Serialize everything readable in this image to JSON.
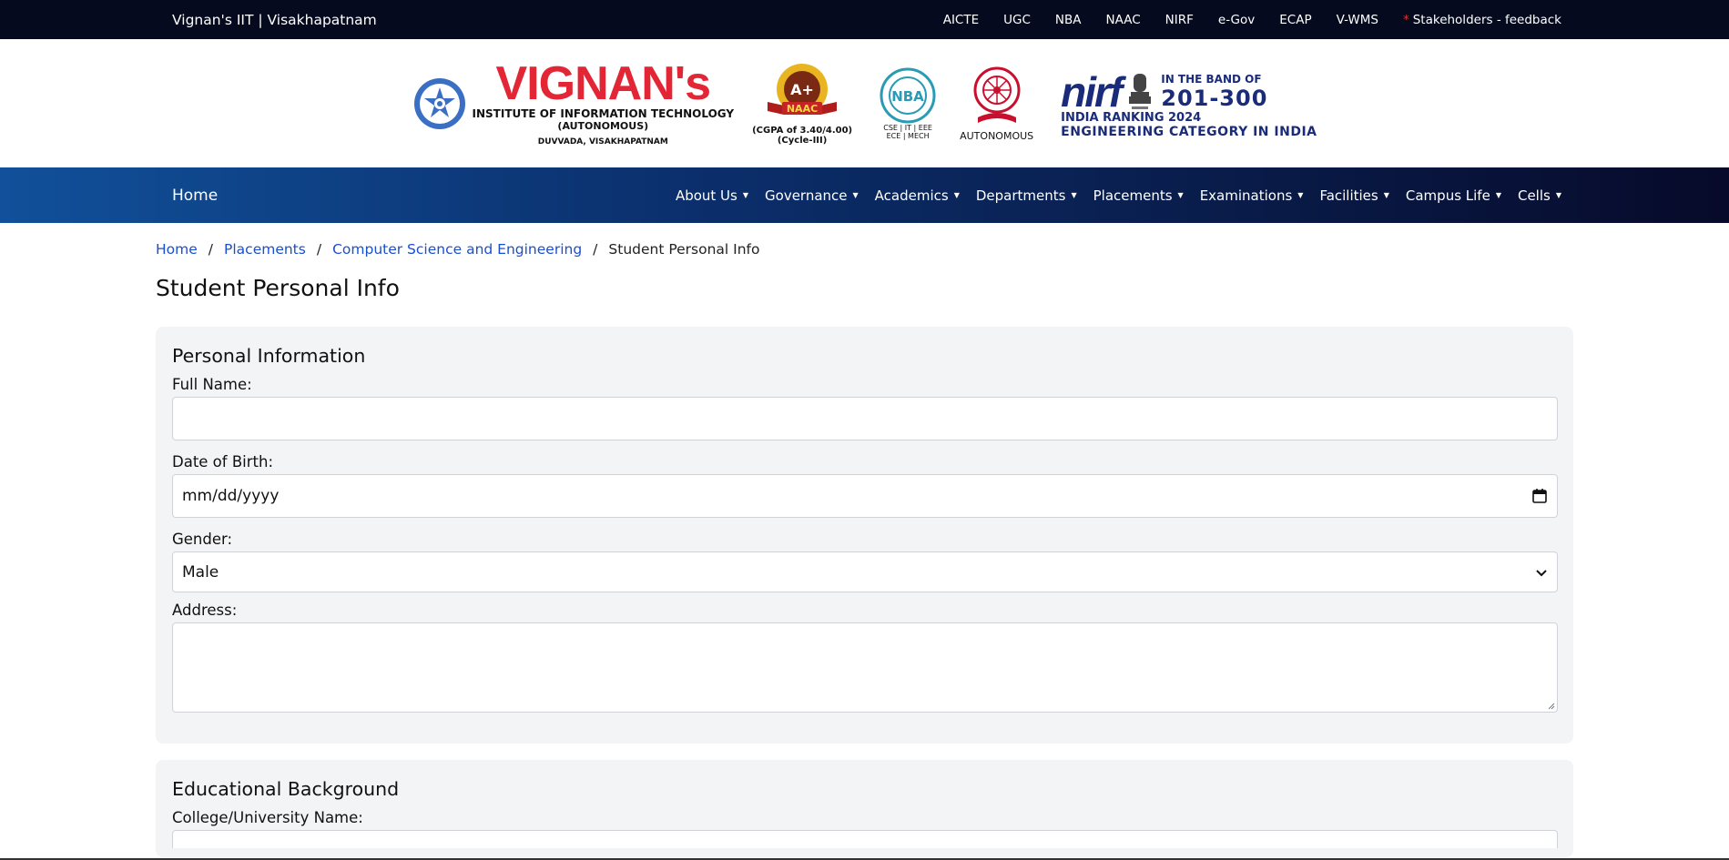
{
  "topbar": {
    "site_name": "Vignan's IIT | Visakhapatnam",
    "links": [
      "AICTE",
      "UGC",
      "NBA",
      "NAAC",
      "NIRF",
      "e-Gov",
      "ECAP",
      "V-WMS"
    ],
    "feedback": "Stakeholders - feedback"
  },
  "logos": {
    "vignan_name": "VIGNAN's",
    "vignan_sub1": "INSTITUTE OF INFORMATION TECHNOLOGY",
    "vignan_sub2": "(AUTONOMOUS)",
    "vignan_sub3": "DUVVADA, VISAKHAPATNAM",
    "naac_grade": "A+",
    "naac_label": "NAAC",
    "naac_cap1": "(CGPA of 3.40/4.00)",
    "naac_cap2": "(Cycle-III)",
    "nba_label": "NBA",
    "nba_cap1": "CSE | IT | EEE",
    "nba_cap2": "ECE | MECH",
    "ugc_cap": "AUTONOMOUS",
    "nirf_word": "nirf",
    "nirf_band1": "IN THE BAND OF",
    "nirf_band2": "201-300",
    "nirf_rank": "INDIA RANKING 2024",
    "nirf_cat": "ENGINEERING CATEGORY IN INDIA"
  },
  "nav": {
    "home": "Home",
    "items": [
      "About Us",
      "Governance",
      "Academics",
      "Departments",
      "Placements",
      "Examinations",
      "Facilities",
      "Campus Life",
      "Cells"
    ]
  },
  "breadcrumb": {
    "home": "Home",
    "placements": "Placements",
    "dept": "Computer Science and Engineering",
    "current": "Student Personal Info"
  },
  "page": {
    "title": "Student Personal Info"
  },
  "personal": {
    "heading": "Personal Information",
    "full_name_label": "Full Name:",
    "full_name_value": "",
    "dob_label": "Date of Birth:",
    "dob_placeholder": "mm/dd/yyyy",
    "gender_label": "Gender:",
    "gender_value": "Male",
    "address_label": "Address:",
    "address_value": ""
  },
  "education": {
    "heading": "Educational Background",
    "college_label": "College/University Name:"
  },
  "icons": {
    "calendar": "calendar-icon",
    "chevron": "chevron-down-icon"
  },
  "colors": {
    "topbar_bg": "#050a1e",
    "nav_start": "#11509a",
    "nav_end": "#070a2a",
    "link": "#1a4fd0",
    "brand_red": "#e32636",
    "card_bg": "#f3f4f6"
  }
}
